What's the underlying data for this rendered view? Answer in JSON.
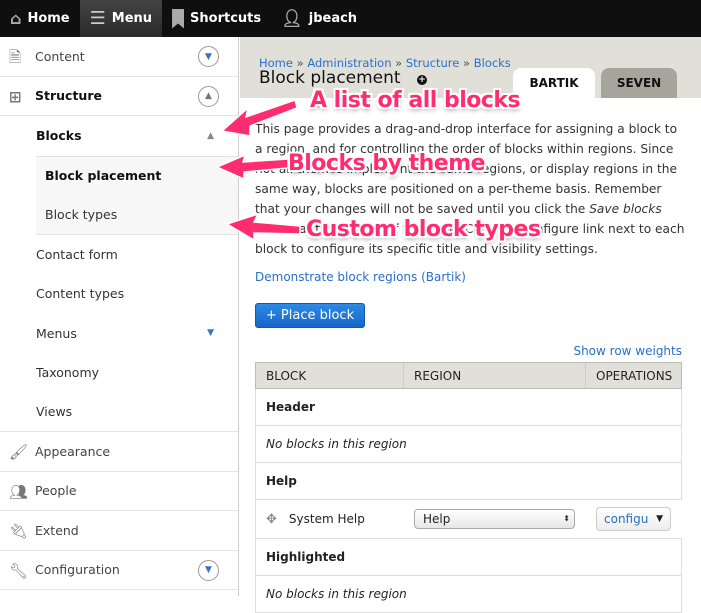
{
  "toolbar": {
    "home": "Home",
    "menu": "Menu",
    "shortcuts": "Shortcuts",
    "user": "jbeach"
  },
  "sidebar": {
    "content": "Content",
    "structure": "Structure",
    "blocks": "Blocks",
    "block_placement": "Block placement",
    "block_types": "Block types",
    "contact_form": "Contact form",
    "content_types": "Content types",
    "menus": "Menus",
    "taxonomy": "Taxonomy",
    "views": "Views",
    "appearance": "Appearance",
    "people": "People",
    "extend": "Extend",
    "configuration": "Configuration"
  },
  "breadcrumb": [
    "Home",
    "Administration",
    "Structure",
    "Blocks"
  ],
  "page_title": "Block placement",
  "tabs": [
    "BARTIK",
    "SEVEN"
  ],
  "description": {
    "p1": "This page provides a drag-and-drop interface for assigning a block to a region, and for controlling the order of blocks within regions. Since not all themes implement the same regions, or display regions in the same way, blocks are positioned on a per-theme basis. Remember that your changes will not be saved until you click the ",
    "em": "Save blocks",
    "p2": " button at the bottom of the page. Click the configure link next to each block to configure its specific title and visibility settings."
  },
  "demo_link": "Demonstrate block regions (Bartik)",
  "place_block": "+ Place block",
  "show_row_weights": "Show row weights",
  "table": {
    "headers": [
      "BLOCK",
      "REGION",
      "OPERATIONS"
    ],
    "header_region": "Header",
    "empty": "No blocks in this region",
    "help_region": "Help",
    "system_help": "System Help",
    "region_value": "Help",
    "configure": "configu",
    "highlighted_region": "Highlighted"
  },
  "annotations": [
    "A list of all blocks",
    "Blocks by theme",
    "Custom block types"
  ],
  "colors": {
    "annotation": "#ff2d6f",
    "link": "#2a6fc9",
    "button": "#1a7ad6",
    "header_bg": "#e1e0d8"
  }
}
